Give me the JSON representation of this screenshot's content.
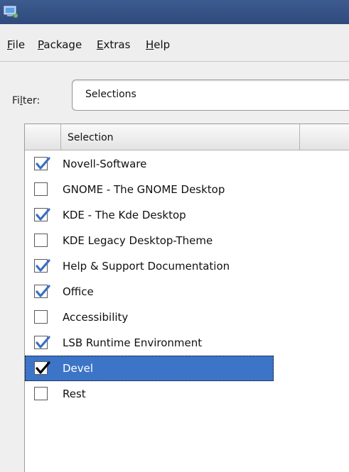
{
  "window": {
    "app_icon": "yast-computer-icon"
  },
  "menu": [
    {
      "mnemonic": "F",
      "rest": "ile"
    },
    {
      "mnemonic": "P",
      "rest": "ackage"
    },
    {
      "mnemonic": "E",
      "rest": "xtras"
    },
    {
      "mnemonic": "H",
      "rest": "elp"
    }
  ],
  "filter": {
    "label_pre": "Fi",
    "label_mn": "l",
    "label_post": "ter:",
    "value": "Selections"
  },
  "table": {
    "headers": {
      "check": "",
      "selection": "Selection"
    },
    "rows": [
      {
        "label": "Novell-Software",
        "checked": true,
        "selected": false
      },
      {
        "label": "GNOME - The GNOME Desktop",
        "checked": false,
        "selected": false
      },
      {
        "label": "KDE - The Kde Desktop",
        "checked": true,
        "selected": false
      },
      {
        "label": "KDE Legacy Desktop-Theme",
        "checked": false,
        "selected": false
      },
      {
        "label": "Help & Support Documentation",
        "checked": true,
        "selected": false
      },
      {
        "label": "Office",
        "checked": true,
        "selected": false
      },
      {
        "label": "Accessibility",
        "checked": false,
        "selected": false
      },
      {
        "label": "LSB Runtime Environment",
        "checked": true,
        "selected": false
      },
      {
        "label": "Devel",
        "checked": true,
        "selected": true
      },
      {
        "label": "Rest",
        "checked": false,
        "selected": false
      }
    ]
  },
  "colors": {
    "titlebar": "#2f4a7c",
    "selection": "#3c75c8",
    "check_blue": "#3a6fc4"
  }
}
